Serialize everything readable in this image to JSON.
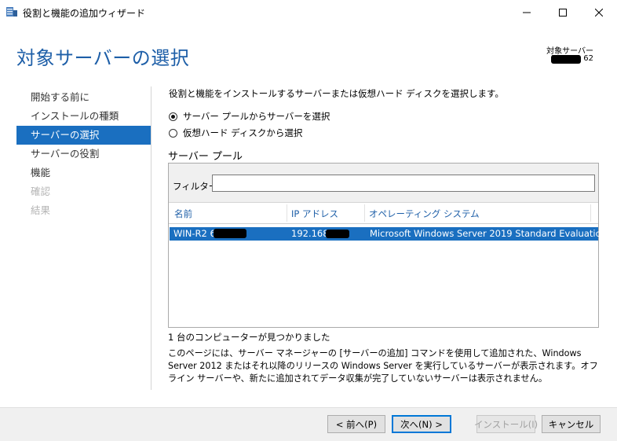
{
  "window": {
    "title": "役割と機能の追加ウィザード"
  },
  "header": {
    "page_title": "対象サーバーの選択",
    "target_label": "対象サーバー",
    "target_name": "WIN-R2            62"
  },
  "nav": {
    "items": [
      {
        "label": "開始する前に",
        "state": "normal"
      },
      {
        "label": "インストールの種類",
        "state": "normal"
      },
      {
        "label": "サーバーの選択",
        "state": "active"
      },
      {
        "label": "サーバーの役割",
        "state": "normal"
      },
      {
        "label": "機能",
        "state": "normal"
      },
      {
        "label": "確認",
        "state": "disabled"
      },
      {
        "label": "結果",
        "state": "disabled"
      }
    ]
  },
  "content": {
    "description": "役割と機能をインストールするサーバーまたは仮想ハード ディスクを選択します。",
    "radio_pool": "サーバー プールからサーバーを選択",
    "radio_vhd": "仮想ハード ディスクから選択",
    "pool_title": "サーバー プール",
    "filter_label": "フィルター:",
    "filter_value": "",
    "columns": {
      "name": "名前",
      "ip": "IP アドレス",
      "os": "オペレーティング システム"
    },
    "rows": [
      {
        "name": "WIN-R2            62",
        "ip": "192.168.",
        "os": "Microsoft Windows Server 2019 Standard Evaluation"
      }
    ],
    "found_text": "1 台のコンピューターが見つかりました",
    "note": "このページには、サーバー マネージャーの [サーバーの追加] コマンドを使用して追加された、Windows Server 2012 またはそれ以降のリリースの Windows Server を実行しているサーバーが表示されます。オフライン サーバーや、新たに追加されてデータ収集が完了していないサーバーは表示されません。"
  },
  "buttons": {
    "prev": "< 前へ(P)",
    "next": "次へ(N) >",
    "install": "インストール(I)",
    "cancel": "キャンセル"
  },
  "colors": {
    "accent": "#1a6fc0",
    "title_blue": "#1e5fa8"
  }
}
